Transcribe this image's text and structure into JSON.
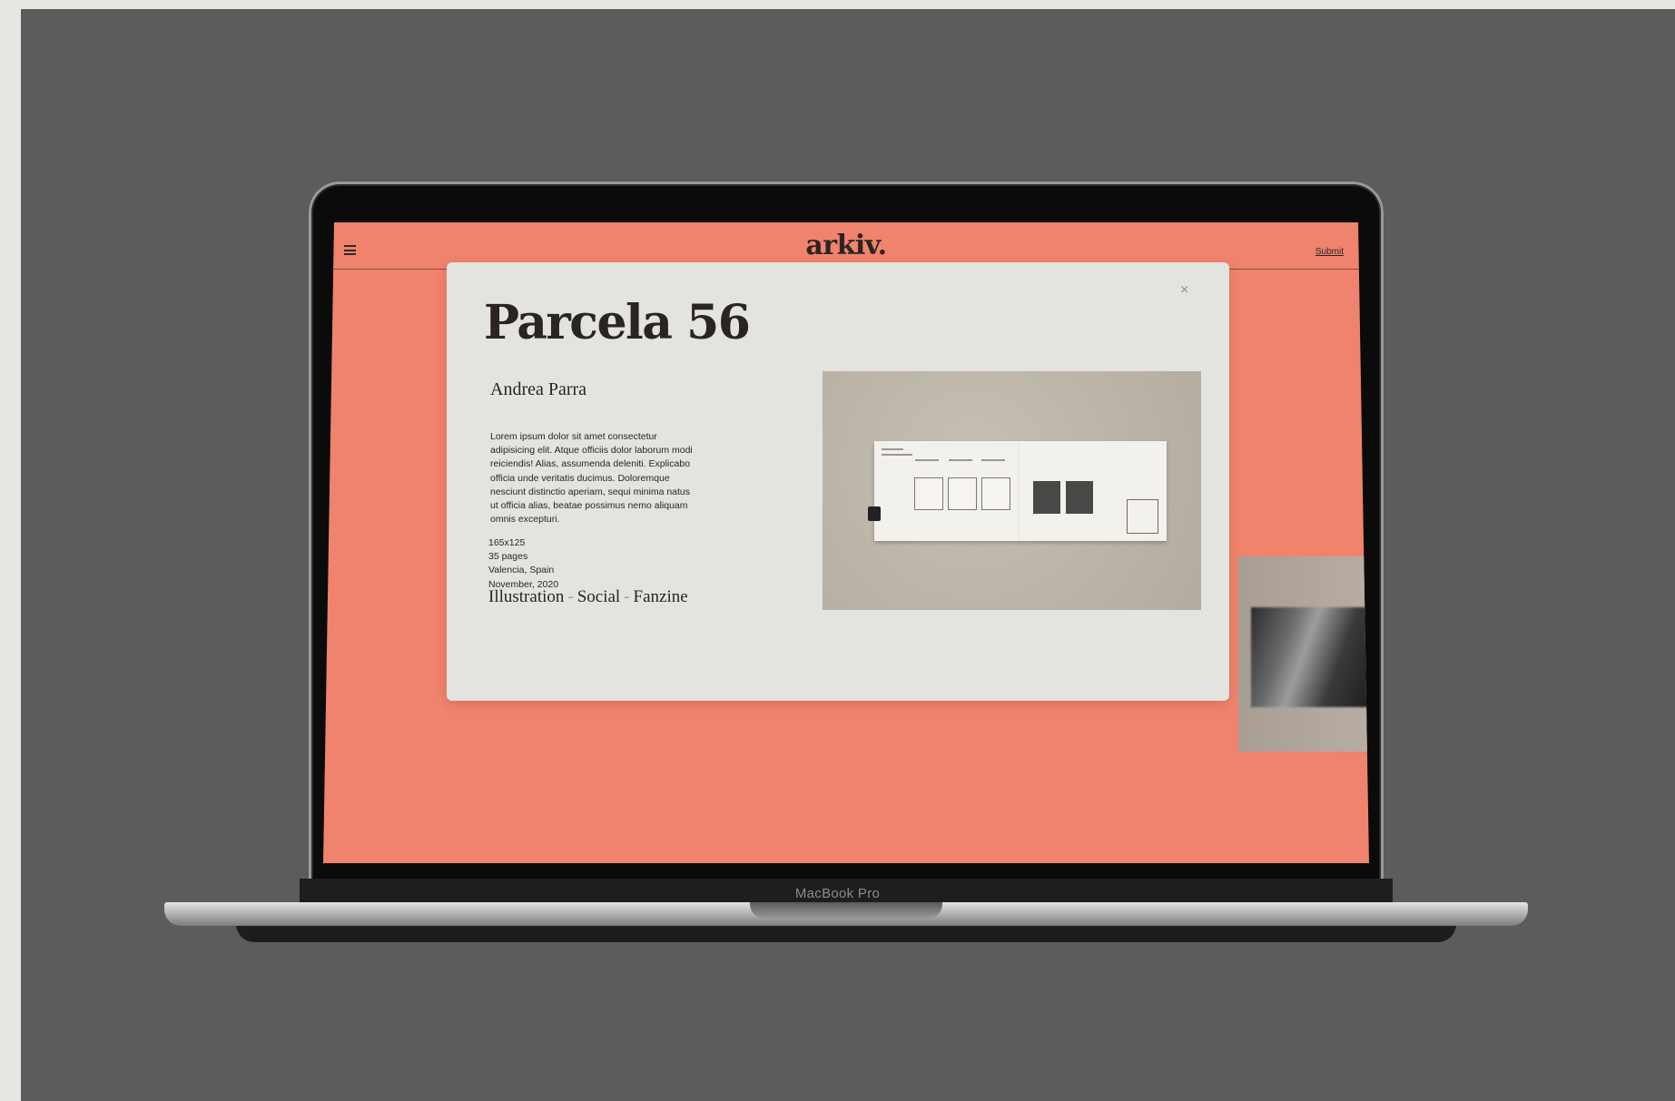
{
  "device": {
    "model_label": "MacBook Pro"
  },
  "site": {
    "logo": "arkiv.",
    "submit_label": "Submit",
    "menu_icon": "hamburger-menu-icon"
  },
  "modal": {
    "close_label": "×",
    "title": "Parcela 56",
    "author": "Andrea Parra",
    "description": "Lorem ipsum dolor sit amet consectetur adipisicing elit. Atque officiis dolor laborum modi reiciendis! Alias, assumenda deleniti. Explicabo officia unde veritatis ducimus. Doloremque nesciunt distinctio aperiam, sequi minima natus ut officia alias, beatae possimus nemo aliquam omnis excepturi.",
    "meta": {
      "size": "165x125",
      "pages": "35 pages",
      "location": "Valencia, Spain",
      "date": "November, 2020"
    },
    "tags": [
      "Illustration",
      "Social",
      "Fanzine"
    ],
    "tag_separator": "-"
  },
  "colors": {
    "screen_background": "#f0836d",
    "modal_background": "#e3e3df",
    "outer_background": "#5d5c5d"
  }
}
